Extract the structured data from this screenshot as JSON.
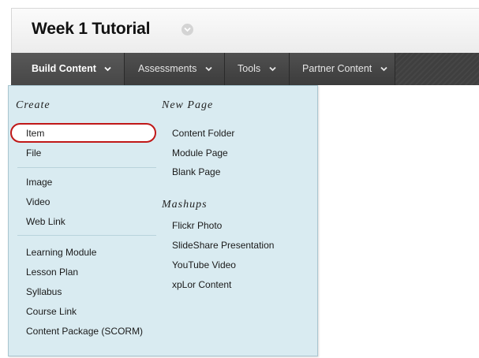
{
  "page": {
    "title": "Week 1 Tutorial"
  },
  "toolbar": {
    "items": [
      {
        "label": "Build Content"
      },
      {
        "label": "Assessments"
      },
      {
        "label": "Tools"
      },
      {
        "label": "Partner Content"
      }
    ]
  },
  "menu": {
    "create": {
      "heading": "Create",
      "groups": [
        [
          "Item",
          "File"
        ],
        [
          "Image",
          "Video",
          "Web Link"
        ],
        [
          "Learning Module",
          "Lesson Plan",
          "Syllabus",
          "Course Link",
          "Content Package (SCORM)"
        ]
      ]
    },
    "new_page": {
      "heading": "New Page",
      "items": [
        "Content Folder",
        "Module Page",
        "Blank Page"
      ]
    },
    "mashups": {
      "heading": "Mashups",
      "items": [
        "Flickr Photo",
        "SlideShare Presentation",
        "YouTube Video",
        "xpLor Content"
      ]
    }
  },
  "colors": {
    "toolbar_bg": "#3f3f3f",
    "menu_bg": "#d9ebf1",
    "highlight_ring": "#c01818"
  }
}
